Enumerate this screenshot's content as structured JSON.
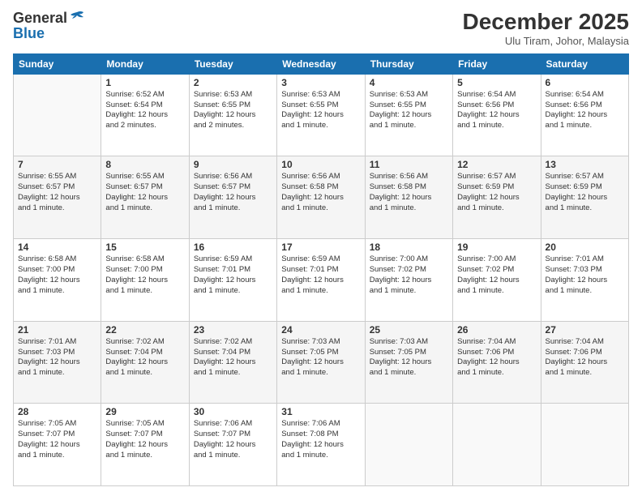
{
  "logo": {
    "general": "General",
    "blue": "Blue"
  },
  "header": {
    "month_title": "December 2025",
    "location": "Ulu Tiram, Johor, Malaysia"
  },
  "weekdays": [
    "Sunday",
    "Monday",
    "Tuesday",
    "Wednesday",
    "Thursday",
    "Friday",
    "Saturday"
  ],
  "weeks": [
    [
      {
        "day": "",
        "info": ""
      },
      {
        "day": "1",
        "info": "Sunrise: 6:52 AM\nSunset: 6:54 PM\nDaylight: 12 hours\nand 2 minutes."
      },
      {
        "day": "2",
        "info": "Sunrise: 6:53 AM\nSunset: 6:55 PM\nDaylight: 12 hours\nand 2 minutes."
      },
      {
        "day": "3",
        "info": "Sunrise: 6:53 AM\nSunset: 6:55 PM\nDaylight: 12 hours\nand 1 minute."
      },
      {
        "day": "4",
        "info": "Sunrise: 6:53 AM\nSunset: 6:55 PM\nDaylight: 12 hours\nand 1 minute."
      },
      {
        "day": "5",
        "info": "Sunrise: 6:54 AM\nSunset: 6:56 PM\nDaylight: 12 hours\nand 1 minute."
      },
      {
        "day": "6",
        "info": "Sunrise: 6:54 AM\nSunset: 6:56 PM\nDaylight: 12 hours\nand 1 minute."
      }
    ],
    [
      {
        "day": "7",
        "info": "Sunrise: 6:55 AM\nSunset: 6:57 PM\nDaylight: 12 hours\nand 1 minute."
      },
      {
        "day": "8",
        "info": "Sunrise: 6:55 AM\nSunset: 6:57 PM\nDaylight: 12 hours\nand 1 minute."
      },
      {
        "day": "9",
        "info": "Sunrise: 6:56 AM\nSunset: 6:57 PM\nDaylight: 12 hours\nand 1 minute."
      },
      {
        "day": "10",
        "info": "Sunrise: 6:56 AM\nSunset: 6:58 PM\nDaylight: 12 hours\nand 1 minute."
      },
      {
        "day": "11",
        "info": "Sunrise: 6:56 AM\nSunset: 6:58 PM\nDaylight: 12 hours\nand 1 minute."
      },
      {
        "day": "12",
        "info": "Sunrise: 6:57 AM\nSunset: 6:59 PM\nDaylight: 12 hours\nand 1 minute."
      },
      {
        "day": "13",
        "info": "Sunrise: 6:57 AM\nSunset: 6:59 PM\nDaylight: 12 hours\nand 1 minute."
      }
    ],
    [
      {
        "day": "14",
        "info": "Sunrise: 6:58 AM\nSunset: 7:00 PM\nDaylight: 12 hours\nand 1 minute."
      },
      {
        "day": "15",
        "info": "Sunrise: 6:58 AM\nSunset: 7:00 PM\nDaylight: 12 hours\nand 1 minute."
      },
      {
        "day": "16",
        "info": "Sunrise: 6:59 AM\nSunset: 7:01 PM\nDaylight: 12 hours\nand 1 minute."
      },
      {
        "day": "17",
        "info": "Sunrise: 6:59 AM\nSunset: 7:01 PM\nDaylight: 12 hours\nand 1 minute."
      },
      {
        "day": "18",
        "info": "Sunrise: 7:00 AM\nSunset: 7:02 PM\nDaylight: 12 hours\nand 1 minute."
      },
      {
        "day": "19",
        "info": "Sunrise: 7:00 AM\nSunset: 7:02 PM\nDaylight: 12 hours\nand 1 minute."
      },
      {
        "day": "20",
        "info": "Sunrise: 7:01 AM\nSunset: 7:03 PM\nDaylight: 12 hours\nand 1 minute."
      }
    ],
    [
      {
        "day": "21",
        "info": "Sunrise: 7:01 AM\nSunset: 7:03 PM\nDaylight: 12 hours\nand 1 minute."
      },
      {
        "day": "22",
        "info": "Sunrise: 7:02 AM\nSunset: 7:04 PM\nDaylight: 12 hours\nand 1 minute."
      },
      {
        "day": "23",
        "info": "Sunrise: 7:02 AM\nSunset: 7:04 PM\nDaylight: 12 hours\nand 1 minute."
      },
      {
        "day": "24",
        "info": "Sunrise: 7:03 AM\nSunset: 7:05 PM\nDaylight: 12 hours\nand 1 minute."
      },
      {
        "day": "25",
        "info": "Sunrise: 7:03 AM\nSunset: 7:05 PM\nDaylight: 12 hours\nand 1 minute."
      },
      {
        "day": "26",
        "info": "Sunrise: 7:04 AM\nSunset: 7:06 PM\nDaylight: 12 hours\nand 1 minute."
      },
      {
        "day": "27",
        "info": "Sunrise: 7:04 AM\nSunset: 7:06 PM\nDaylight: 12 hours\nand 1 minute."
      }
    ],
    [
      {
        "day": "28",
        "info": "Sunrise: 7:05 AM\nSunset: 7:07 PM\nDaylight: 12 hours\nand 1 minute."
      },
      {
        "day": "29",
        "info": "Sunrise: 7:05 AM\nSunset: 7:07 PM\nDaylight: 12 hours\nand 1 minute."
      },
      {
        "day": "30",
        "info": "Sunrise: 7:06 AM\nSunset: 7:07 PM\nDaylight: 12 hours\nand 1 minute."
      },
      {
        "day": "31",
        "info": "Sunrise: 7:06 AM\nSunset: 7:08 PM\nDaylight: 12 hours\nand 1 minute."
      },
      {
        "day": "",
        "info": ""
      },
      {
        "day": "",
        "info": ""
      },
      {
        "day": "",
        "info": ""
      }
    ]
  ]
}
